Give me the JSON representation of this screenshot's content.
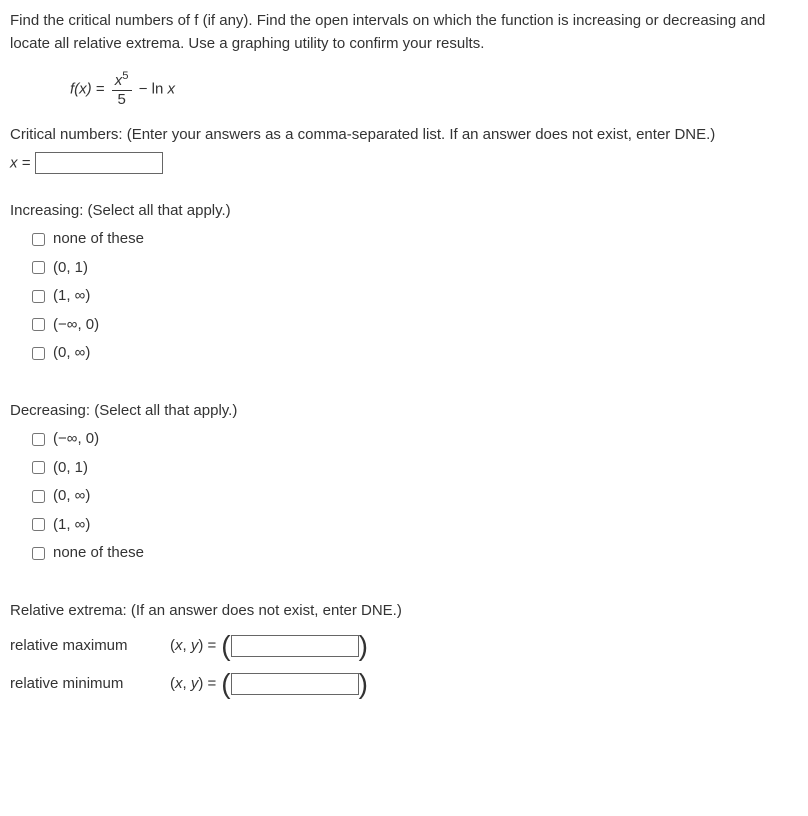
{
  "intro": "Find the critical numbers of f (if any). Find the open intervals on which the function is increasing or decreasing and locate all relative extrema. Use a graphing utility to confirm your results.",
  "equation": {
    "lhs": "f(x)",
    "eq": " = ",
    "num_base": "x",
    "num_exp": "5",
    "den": "5",
    "minus": " − ln ",
    "varx": "x"
  },
  "critical": {
    "prompt": "Critical numbers: (Enter your answers as a comma-separated list. If an answer does not exist, enter DNE.)",
    "label": "x = "
  },
  "increasing": {
    "title": "Increasing: (Select all that apply.)",
    "options": [
      "none of these",
      "(0, 1)",
      "(1, ∞)",
      "(−∞, 0)",
      "(0, ∞)"
    ]
  },
  "decreasing": {
    "title": "Decreasing: (Select all that apply.)",
    "options": [
      "(−∞, 0)",
      "(0, 1)",
      "(0, ∞)",
      "(1, ∞)",
      "none of these"
    ]
  },
  "extrema": {
    "prompt": "Relative extrema: (If an answer does not exist, enter DNE.)",
    "max_label": "relative maximum",
    "min_label": "relative minimum",
    "xy_eq": "(x, y) = "
  }
}
